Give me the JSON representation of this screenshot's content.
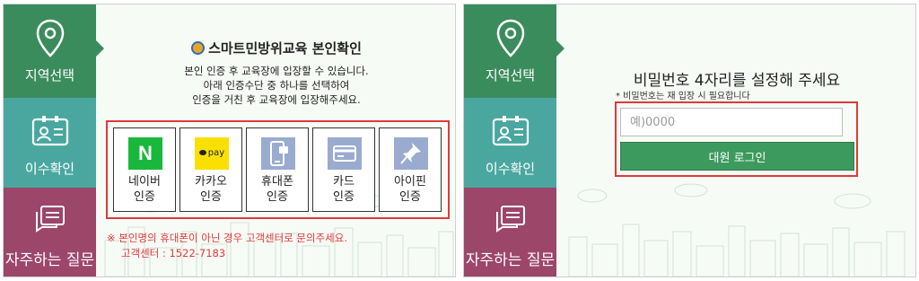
{
  "left_panel": {
    "sidebar": {
      "region": "지역선택",
      "check": "이수확인",
      "faq": "자주하는 질문"
    },
    "title": "스마트민방위교육 본인확인",
    "description": [
      "본인 인증 후 교육장에 입장할 수 있습니다.",
      "아래 인증수단 중 하나를 선택하여",
      "인증을 거친 후 교육장에 입장해주세요."
    ],
    "auth_methods": [
      {
        "label_1": "네이버",
        "label_2": "인증",
        "icon": "naver-icon",
        "badge_text": "N"
      },
      {
        "label_1": "카카오",
        "label_2": "인증",
        "icon": "kakao-pay-icon",
        "badge_text": "pay"
      },
      {
        "label_1": "휴대폰",
        "label_2": "인증",
        "icon": "phone-icon"
      },
      {
        "label_1": "카드",
        "label_2": "인증",
        "icon": "card-icon"
      },
      {
        "label_1": "아이핀",
        "label_2": "인증",
        "icon": "pin-icon"
      }
    ],
    "notice": "※ 본인명의 휴대폰이 아닌 경우 고객센터로 문의주세요.",
    "support": "고객센터 : 1522-7183"
  },
  "right_panel": {
    "sidebar": {
      "region": "지역선택",
      "check": "이수확인",
      "faq": "자주하는 질문"
    },
    "title": "비밀번호 4자리를 설정해 주세요",
    "subtitle": "* 비밀번호는 재 입장 시 필요합니다",
    "password_placeholder": "예)0000",
    "login_button": "대원 로그인"
  },
  "colors": {
    "region": "#3b8c5c",
    "check": "#4aa7a0",
    "faq": "#9c4669",
    "highlight": "#e03a3a",
    "button": "#3d9a5e"
  }
}
